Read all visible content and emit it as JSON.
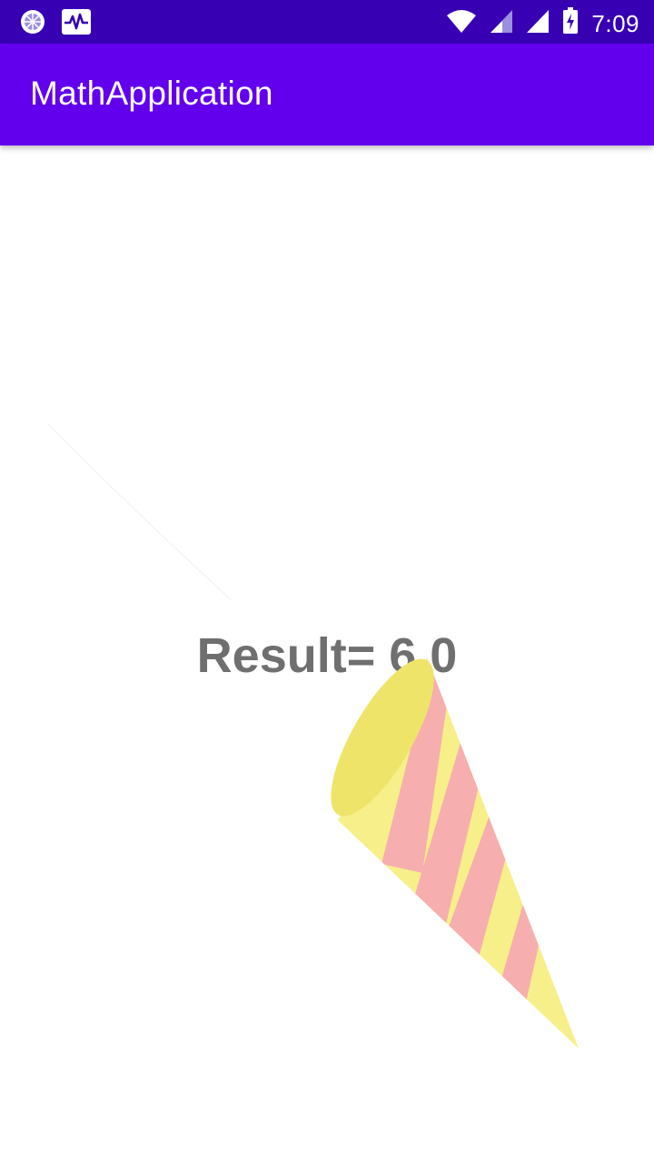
{
  "status_bar": {
    "time": "7:09",
    "background_color": "#3700b3",
    "left_icons": [
      "loading-circle-icon",
      "activity-pulse-icon"
    ],
    "right_icons": [
      "wifi-icon",
      "signal-icon",
      "signal-icon",
      "battery-charging-icon"
    ]
  },
  "app_bar": {
    "title": "MathApplication",
    "background_color": "#6200ee"
  },
  "main": {
    "result_text": "Result= 6.0",
    "decoration": "party-hat-icon"
  }
}
